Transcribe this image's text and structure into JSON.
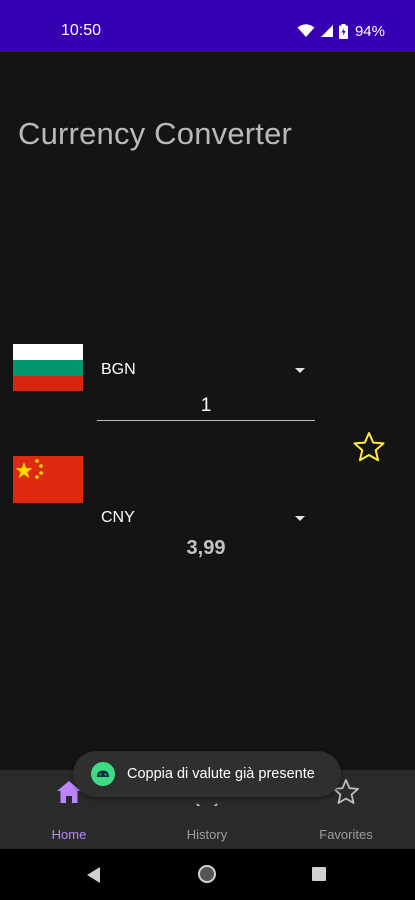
{
  "status_bar": {
    "time": "10:50",
    "battery_percent": "94%",
    "background_color": "#3700b3"
  },
  "app": {
    "title": "Currency Converter"
  },
  "converter": {
    "from": {
      "currency": "BGN",
      "flag": "bulgaria-flag",
      "amount": "1"
    },
    "to": {
      "currency": "CNY",
      "flag": "china-flag",
      "result": "3,99"
    },
    "favorite_icon": "star-outline-icon",
    "favorite_color": "#ffeb3b"
  },
  "toast": {
    "message": "Coppia di valute già presente"
  },
  "bottom_nav": {
    "items": [
      {
        "label": "Home",
        "icon": "home-icon",
        "active": true
      },
      {
        "label": "History",
        "icon": "history-icon",
        "active": false
      },
      {
        "label": "Favorites",
        "icon": "star-icon",
        "active": false
      }
    ],
    "active_color": "#bb86fc"
  }
}
